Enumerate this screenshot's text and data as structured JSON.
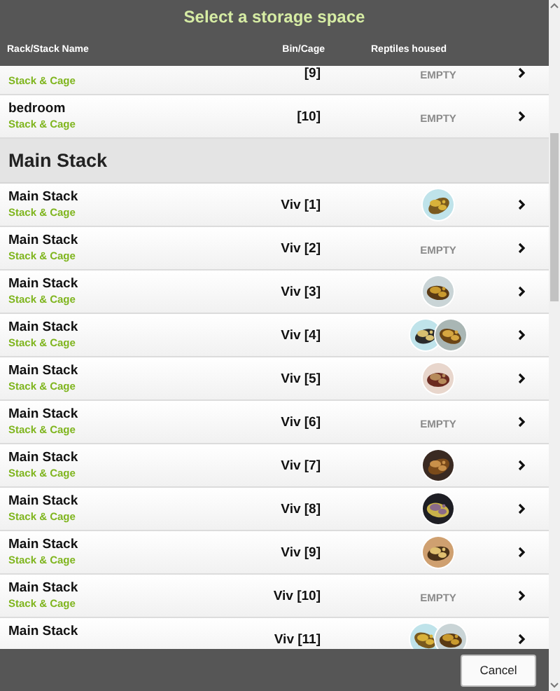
{
  "header": {
    "title": "Select a storage space",
    "columns": [
      "Rack/Stack Name",
      "Bin/Cage",
      "Reptiles housed"
    ]
  },
  "rows": [
    {
      "kind": "row",
      "type": "Stack & Cage",
      "cage": "[9]",
      "status": "EMPTY"
    },
    {
      "kind": "row",
      "name": "bedroom",
      "type": "Stack & Cage",
      "cage": "[10]",
      "status": "EMPTY"
    },
    {
      "kind": "section",
      "name": "Main Stack"
    },
    {
      "kind": "row",
      "name": "Main Stack",
      "type": "Stack & Cage",
      "cage": "Viv [1]"
    },
    {
      "kind": "row",
      "name": "Main Stack",
      "type": "Stack & Cage",
      "cage": "Viv [2]",
      "status": "EMPTY"
    },
    {
      "kind": "row",
      "name": "Main Stack",
      "type": "Stack & Cage",
      "cage": "Viv [3]"
    },
    {
      "kind": "row",
      "name": "Main Stack",
      "type": "Stack & Cage",
      "cage": "Viv [4]"
    },
    {
      "kind": "row",
      "name": "Main Stack",
      "type": "Stack & Cage",
      "cage": "Viv [5]"
    },
    {
      "kind": "row",
      "name": "Main Stack",
      "type": "Stack & Cage",
      "cage": "Viv [6]",
      "status": "EMPTY"
    },
    {
      "kind": "row",
      "name": "Main Stack",
      "type": "Stack & Cage",
      "cage": "Viv [7]"
    },
    {
      "kind": "row",
      "name": "Main Stack",
      "type": "Stack & Cage",
      "cage": "Viv [8]"
    },
    {
      "kind": "row",
      "name": "Main Stack",
      "type": "Stack & Cage",
      "cage": "Viv [9]"
    },
    {
      "kind": "row",
      "name": "Main Stack",
      "type": "Stack & Cage",
      "cage": "Viv [10]",
      "status": "EMPTY"
    },
    {
      "kind": "row",
      "name": "Main Stack",
      "cage": "Viv [11]"
    }
  ],
  "footer": {
    "button": "Cancel"
  }
}
